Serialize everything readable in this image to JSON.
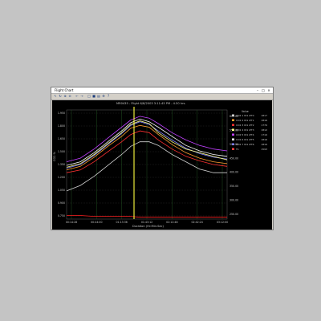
{
  "window": {
    "title": "Flight Chart",
    "minimize_glyph": "–",
    "maximize_glyph": "□",
    "close_glyph": "×"
  },
  "toolbar": {
    "icons": [
      "cursor-icon",
      "refresh-icon",
      "zoom-in-icon",
      "zoom-out-icon",
      "back-icon",
      "forward-icon",
      "copy-icon",
      "save-icon",
      "print-icon",
      "settings-icon",
      "help-icon"
    ]
  },
  "chart_data": {
    "type": "line",
    "title": "MR0435 - Flight 6/8/2003 3:11:45 PM - 4.50 hrs.",
    "xlabel": "Duration (Hr:Min:Sec)",
    "ylabel": "CO2 %",
    "x_ticks": [
      "00:14:28",
      "00:44:00",
      "01:13:36",
      "01:43:12",
      "02:12:48",
      "02:42:24",
      "03:12:00"
    ],
    "y_ticks": [
      "1.950",
      "1.800",
      "1.650",
      "1.500",
      "1.350",
      "1.200",
      "1.050",
      "0.900",
      "0.750"
    ],
    "right_ticks": [
      "600.00",
      "550.00",
      "500.00",
      "450.00",
      "400.00",
      "350.00",
      "300.00",
      "250.00"
    ],
    "legend_header": "Value",
    "legend": [
      {
        "name": "CO2 1  ID1 #T0",
        "value": "1817",
        "color": "#d0d0d0"
      },
      {
        "name": "CO2 2  ID1 #T1",
        "value": "1816",
        "color": "#ff9f2f"
      },
      {
        "name": "CO2 3  ID1 #T2",
        "value": "1776",
        "color": "#ff3030"
      },
      {
        "name": "CO2 4  ID1 #T3",
        "value": "1812",
        "color": "#ffff80"
      },
      {
        "name": "CO2 5  ID1 #T4",
        "value": "1716",
        "color": "#c040ff"
      },
      {
        "name": "CO2 6  ID1 #T5",
        "value": "1816",
        "color": "#ffffff"
      },
      {
        "name": "CO2 7  ID1 #T6",
        "value": "1816",
        "color": "#8080ff"
      },
      {
        "name": "T1",
        "value": "1593",
        "color": "#ff4040"
      }
    ],
    "cursor_x": "01:34:00",
    "x_range_hours": [
      0.1,
      3.6
    ],
    "y_range": [
      0.75,
      1.95
    ],
    "x_hours": [
      0.1,
      0.4,
      0.7,
      1.0,
      1.3,
      1.5,
      1.7,
      1.9,
      2.1,
      2.4,
      2.7,
      3.0,
      3.3,
      3.6
    ],
    "series": [
      {
        "values": [
          1.38,
          1.42,
          1.52,
          1.64,
          1.76,
          1.84,
          1.88,
          1.86,
          1.8,
          1.7,
          1.62,
          1.56,
          1.52,
          1.5
        ],
        "color": "#c040ff"
      },
      {
        "values": [
          1.34,
          1.38,
          1.48,
          1.6,
          1.72,
          1.81,
          1.85,
          1.82,
          1.76,
          1.66,
          1.56,
          1.5,
          1.46,
          1.44
        ],
        "color": "#ffffff"
      },
      {
        "values": [
          1.31,
          1.35,
          1.45,
          1.57,
          1.69,
          1.78,
          1.82,
          1.79,
          1.72,
          1.62,
          1.53,
          1.47,
          1.43,
          1.41
        ],
        "color": "#8080ff"
      },
      {
        "values": [
          1.32,
          1.36,
          1.46,
          1.58,
          1.7,
          1.79,
          1.83,
          1.8,
          1.7,
          1.6,
          1.52,
          1.48,
          1.44,
          1.4
        ],
        "color": "#ffff80"
      },
      {
        "values": [
          1.29,
          1.33,
          1.43,
          1.55,
          1.66,
          1.75,
          1.78,
          1.76,
          1.68,
          1.57,
          1.48,
          1.42,
          1.38,
          1.36
        ],
        "color": "#ff9f2f"
      },
      {
        "values": [
          1.26,
          1.29,
          1.38,
          1.49,
          1.6,
          1.68,
          1.72,
          1.7,
          1.62,
          1.52,
          1.44,
          1.39,
          1.35,
          1.33
        ],
        "color": "#ff3030"
      },
      {
        "values": [
          1.06,
          1.12,
          1.22,
          1.34,
          1.46,
          1.55,
          1.6,
          1.6,
          1.56,
          1.46,
          1.38,
          1.3,
          1.26,
          1.26
        ],
        "color": "#d0d0d0"
      },
      {
        "values": [
          0.79,
          0.79,
          0.78,
          0.78,
          0.78,
          0.78,
          0.77,
          0.77,
          0.77,
          0.77,
          0.77,
          0.77,
          0.77,
          0.77
        ],
        "color": "#ff2020"
      }
    ],
    "grid": true,
    "legend_position": "right"
  }
}
